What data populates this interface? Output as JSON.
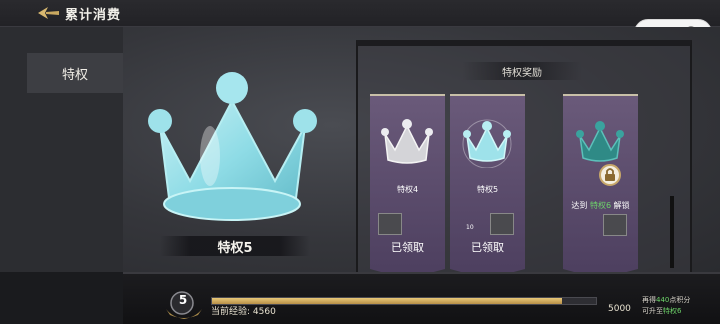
{
  "header": {
    "title": "累计消费"
  },
  "capsule": {
    "more_icon": "more-dots-icon",
    "close_icon": "target-circle-icon"
  },
  "sidebar": {
    "tabs": [
      {
        "label": "特权"
      }
    ]
  },
  "showcase": {
    "name": "特权5"
  },
  "rewards_panel": {
    "title": "特权奖励",
    "cards": [
      {
        "label": "特权4",
        "state": "已领取",
        "crown": "silver-crown-icon"
      },
      {
        "label": "特权5",
        "state": "已领取",
        "crown": "cyan-crown-icon",
        "reward_tag": "10"
      },
      {
        "unlock_prefix": "达到 ",
        "unlock_level": "特权6",
        "unlock_suffix": " 解锁",
        "crown": "teal-crown-icon",
        "locked": true
      }
    ]
  },
  "progress": {
    "level": "5",
    "label": "当前经验:",
    "current": "4560",
    "max": "5000",
    "fraction": 0.912
  },
  "hint": {
    "prefix": "再得",
    "points": "440",
    "middle": "点积分",
    "line2_prefix": "可升至",
    "next_level": "特权6"
  },
  "colors": {
    "accent_green": "#6ed46a",
    "gold": "#d8b870",
    "banner_purple": "#5a4a6c"
  }
}
